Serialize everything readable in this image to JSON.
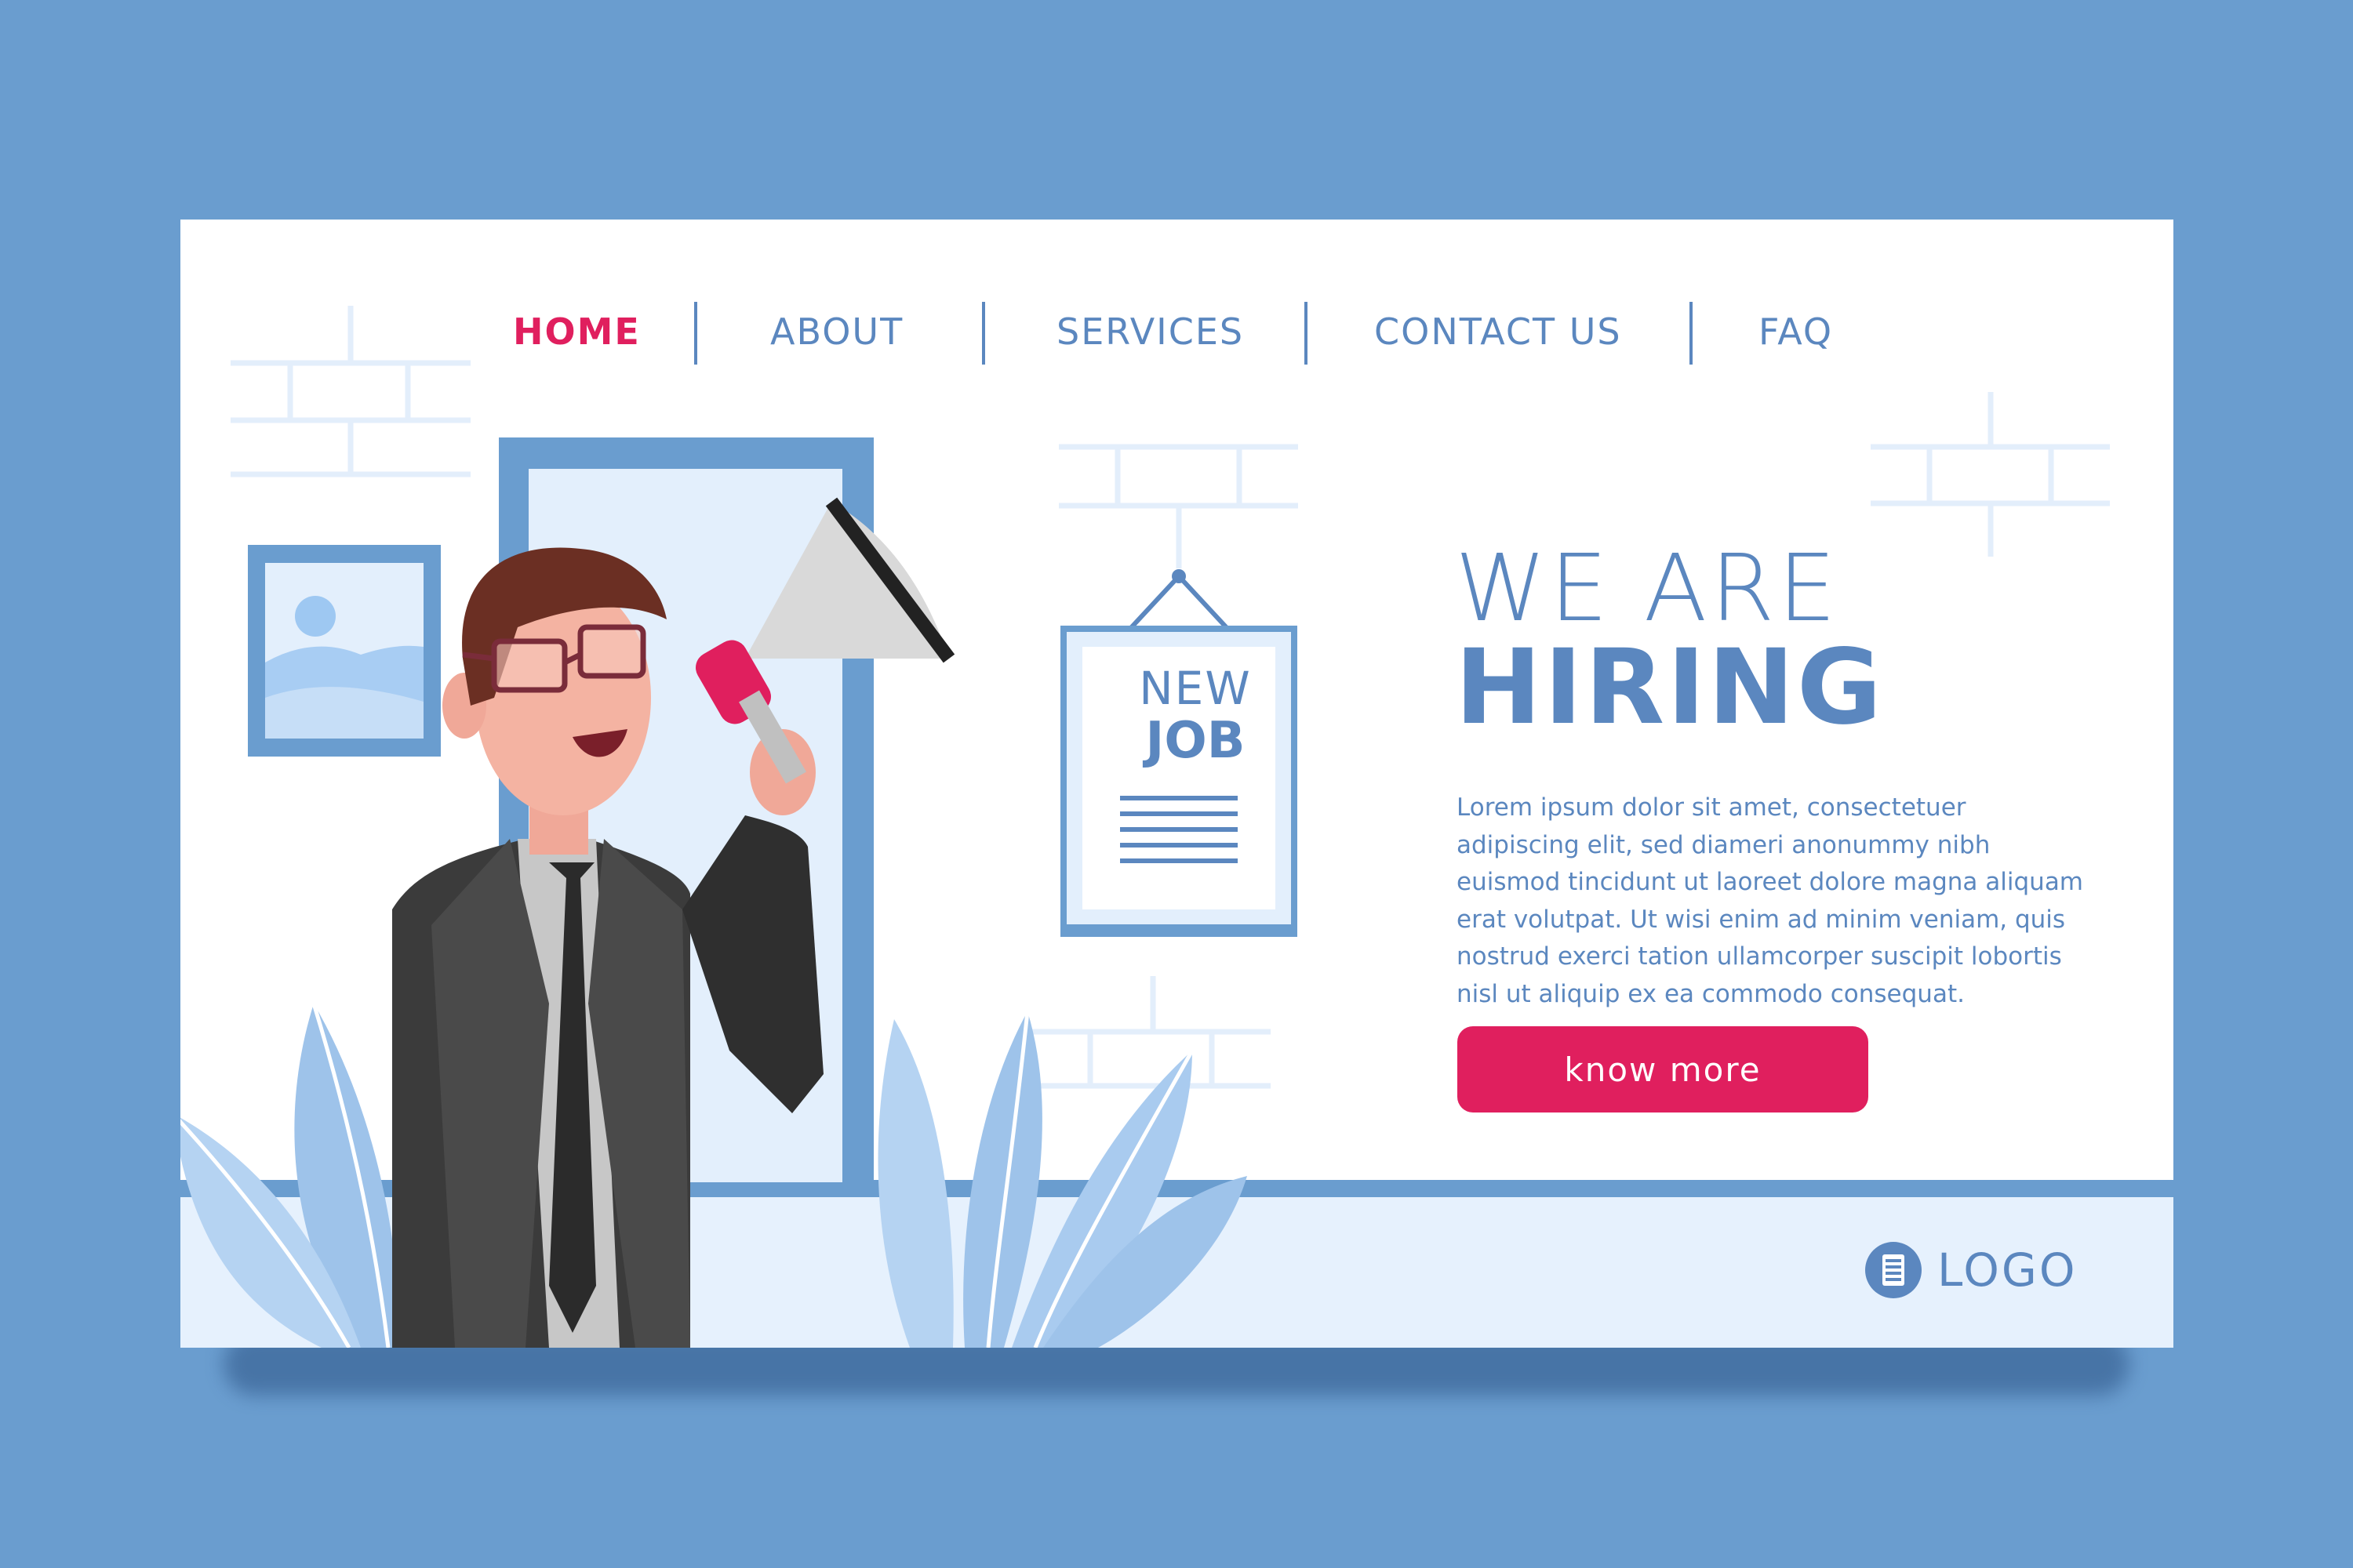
{
  "nav": {
    "items": [
      {
        "label": "HOME",
        "active": true
      },
      {
        "label": "ABOUT",
        "active": false
      },
      {
        "label": "SERVICES",
        "active": false
      },
      {
        "label": "CONTACT US",
        "active": false
      },
      {
        "label": "FAQ",
        "active": false
      }
    ]
  },
  "hero": {
    "title_line1": "WE ARE",
    "title_line2": "HIRING",
    "body": "Lorem ipsum dolor sit amet, consectetuer adipiscing elit, sed diameri anonummy nibh euismod tincidunt ut laoreet dolore magna aliquam erat volutpat. Ut wisi enim ad minim veniam, quis nostrud exerci tation ullamcorper suscipit lobortis nisl ut aliquip ex ea commodo consequat.",
    "cta_label": "know more"
  },
  "sign": {
    "line1": "NEW",
    "line2": "JOB"
  },
  "logo": {
    "text": "LOGO",
    "icon": "document-icon"
  },
  "colors": {
    "background": "#6a9dcf",
    "accent": "#e01f5e",
    "primary_text": "#5b87bf",
    "card": "#ffffff",
    "floor": "#e6f1fd"
  }
}
